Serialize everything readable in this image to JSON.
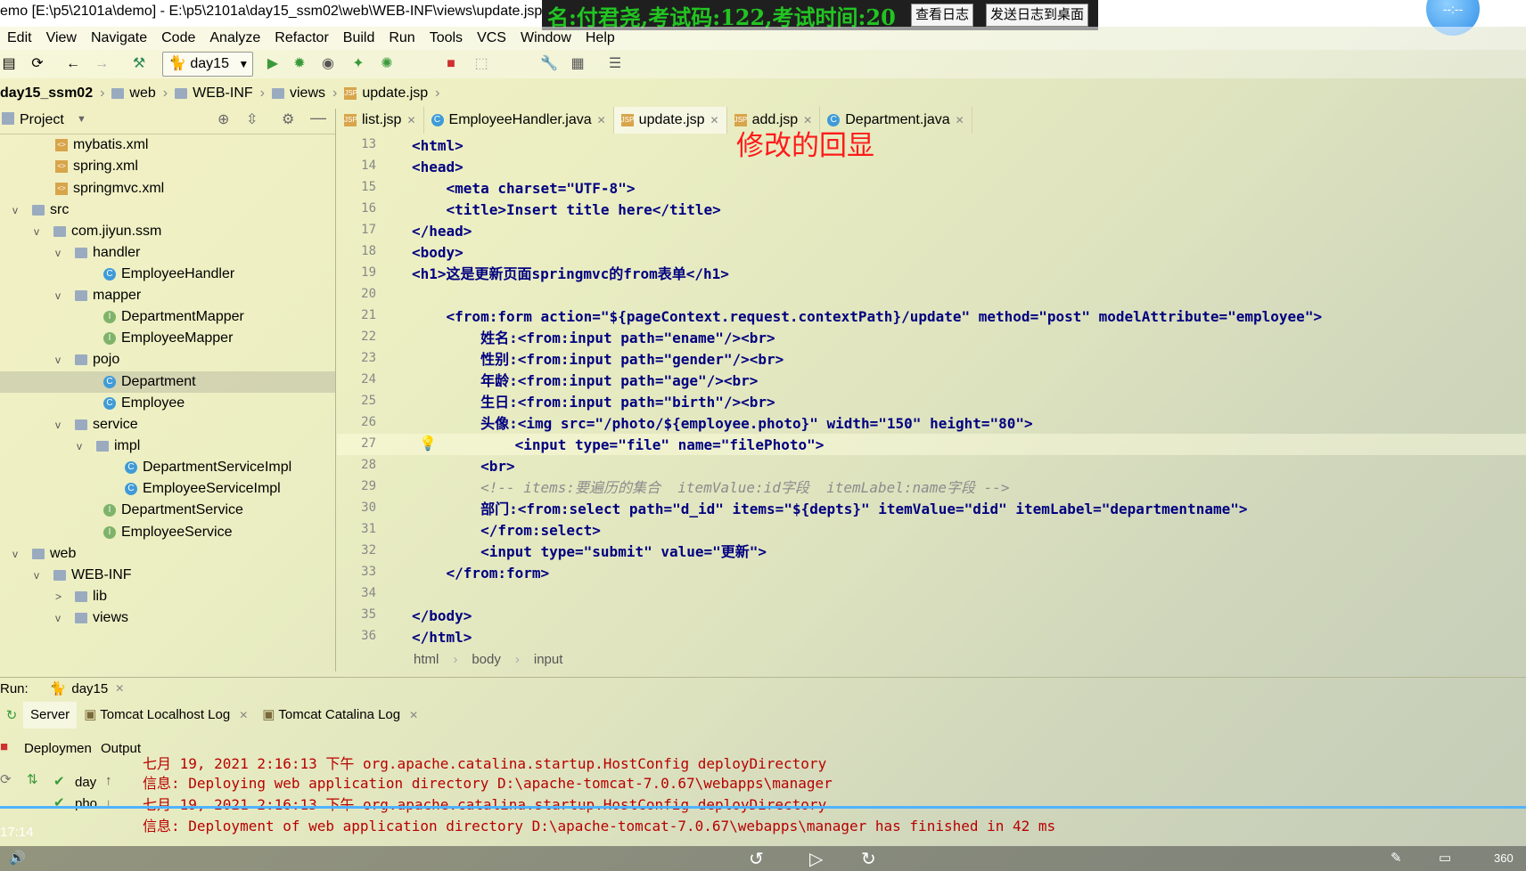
{
  "window": {
    "title": "emo [E:\\p5\\2101a\\demo] - E:\\p5\\2101a\\day15_ssm02\\web\\WEB-INF\\views\\update.jsp"
  },
  "overlay": {
    "text": "名:付君尧,考试码:122,考试时间:20",
    "view_log_button": "查看日志",
    "send_log_button": "发送日志到桌面",
    "bubble": "--:--"
  },
  "menu": [
    "Edit",
    "View",
    "Navigate",
    "Code",
    "Analyze",
    "Refactor",
    "Build",
    "Run",
    "Tools",
    "VCS",
    "Window",
    "Help"
  ],
  "toolbar": {
    "run_config": "day15",
    "icons": [
      "save-icon",
      "sync-icon",
      "back-icon",
      "forward-icon",
      "build-hammer-icon",
      "run-icon",
      "debug-icon",
      "coverage-icon",
      "profile-icon",
      "jrebel-icon",
      "stop-icon",
      "structure-icon",
      "wrench-icon",
      "project-structure-icon",
      "tasks-icon"
    ]
  },
  "breadcrumb": [
    "day15_ssm02",
    "web",
    "WEB-INF",
    "views",
    "update.jsp"
  ],
  "project_panel": {
    "title": "Project",
    "tree": [
      {
        "label": "mybatis.xml",
        "icon": "xml",
        "depth": 0
      },
      {
        "label": "spring.xml",
        "icon": "xml",
        "depth": 0
      },
      {
        "label": "springmvc.xml",
        "icon": "xml",
        "depth": 0
      },
      {
        "label": "src",
        "icon": "folder",
        "arrow": "v",
        "depth": 0
      },
      {
        "label": "com.jiyun.ssm",
        "icon": "folder",
        "arrow": "v",
        "depth": 1
      },
      {
        "label": "handler",
        "icon": "folder",
        "arrow": "v",
        "depth": 2
      },
      {
        "label": "EmployeeHandler",
        "icon": "class",
        "depth": 3
      },
      {
        "label": "mapper",
        "icon": "folder",
        "arrow": "v",
        "depth": 2
      },
      {
        "label": "DepartmentMapper",
        "icon": "interface",
        "depth": 3
      },
      {
        "label": "EmployeeMapper",
        "icon": "interface",
        "depth": 3
      },
      {
        "label": "pojo",
        "icon": "folder",
        "arrow": "v",
        "depth": 2
      },
      {
        "label": "Department",
        "icon": "class",
        "depth": 3,
        "selected": true
      },
      {
        "label": "Employee",
        "icon": "class",
        "depth": 3
      },
      {
        "label": "service",
        "icon": "folder",
        "arrow": "v",
        "depth": 2
      },
      {
        "label": "impl",
        "icon": "folder",
        "arrow": "v",
        "depth": 3
      },
      {
        "label": "DepartmentServiceImpl",
        "icon": "class",
        "depth": 4
      },
      {
        "label": "EmployeeServiceImpl",
        "icon": "class",
        "depth": 4
      },
      {
        "label": "DepartmentService",
        "icon": "interface",
        "depth": 3
      },
      {
        "label": "EmployeeService",
        "icon": "interface",
        "depth": 3
      },
      {
        "label": "web",
        "icon": "folder",
        "arrow": "v",
        "depth": 0
      },
      {
        "label": "WEB-INF",
        "icon": "folder",
        "arrow": "v",
        "depth": 1
      },
      {
        "label": "lib",
        "icon": "folder",
        "arrow": ">",
        "depth": 2
      },
      {
        "label": "views",
        "icon": "folder",
        "arrow": "v",
        "depth": 2
      }
    ]
  },
  "editor_tabs": [
    {
      "label": "list.jsp",
      "icon": "jsp"
    },
    {
      "label": "EmployeeHandler.java",
      "icon": "class"
    },
    {
      "label": "update.jsp",
      "icon": "jsp",
      "active": true
    },
    {
      "label": "add.jsp",
      "icon": "jsp"
    },
    {
      "label": "Department.java",
      "icon": "class"
    }
  ],
  "annotation": "修改的回显",
  "editor": {
    "line_numbers": [
      "13",
      "14",
      "15",
      "16",
      "17",
      "18",
      "19",
      "20",
      "21",
      "22",
      "23",
      "24",
      "25",
      "26",
      "27",
      "28",
      "29",
      "30",
      "31",
      "32",
      "33",
      "34",
      "35",
      "36"
    ],
    "lines": [
      "<html>",
      "<head>",
      "    <meta charset=\"UTF-8\">",
      "    <title>Insert title here</title>",
      "</head>",
      "<body>",
      "<h1>这是更新页面springmvc的from表单</h1>",
      "",
      "    <from:form action=\"${pageContext.request.contextPath}/update\" method=\"post\" modelAttribute=\"employee\">",
      "        姓名:<from:input path=\"ename\"/><br>",
      "        性别:<from:input path=\"gender\"/><br>",
      "        年龄:<from:input path=\"age\"/><br>",
      "        生日:<from:input path=\"birth\"/><br>",
      "        头像:<img src=\"/photo/${employee.photo}\" width=\"150\" height=\"80\">",
      "            <input type=\"file\" name=\"filePhoto\">",
      "        <br>",
      "        <!-- items:要遍历的集合  itemValue:id字段  itemLabel:name字段 -->",
      "        部门:<from:select path=\"d_id\" items=\"${depts}\" itemValue=\"did\" itemLabel=\"departmentname\">",
      "        </from:select>",
      "        <input type=\"submit\" value=\"更新\">",
      "    </from:form>",
      "",
      "</body>",
      "</html>"
    ],
    "breadcrumb": [
      "html",
      "body",
      "input"
    ]
  },
  "run_panel": {
    "label": "Run:",
    "config": "day15",
    "tabs": [
      "Server",
      "Tomcat Localhost Log",
      "Tomcat Catalina Log"
    ],
    "deployment_label": "Deploymen",
    "output_label": "Output",
    "deployments": [
      "day",
      "pho"
    ],
    "log": [
      "七月 19, 2021 2:16:13 下午 org.apache.catalina.startup.HostConfig deployDirectory",
      "信息: Deploying web application directory D:\\apache-tomcat-7.0.67\\webapps\\manager",
      "七月 19, 2021 2:16:13 下午 org.apache.catalina.startup.HostConfig deployDirectory",
      "信息: Deployment of web application directory D:\\apache-tomcat-7.0.67\\webapps\\manager has finished in 42 ms"
    ]
  },
  "video_time": "17:14",
  "bottom_right_text": "360"
}
